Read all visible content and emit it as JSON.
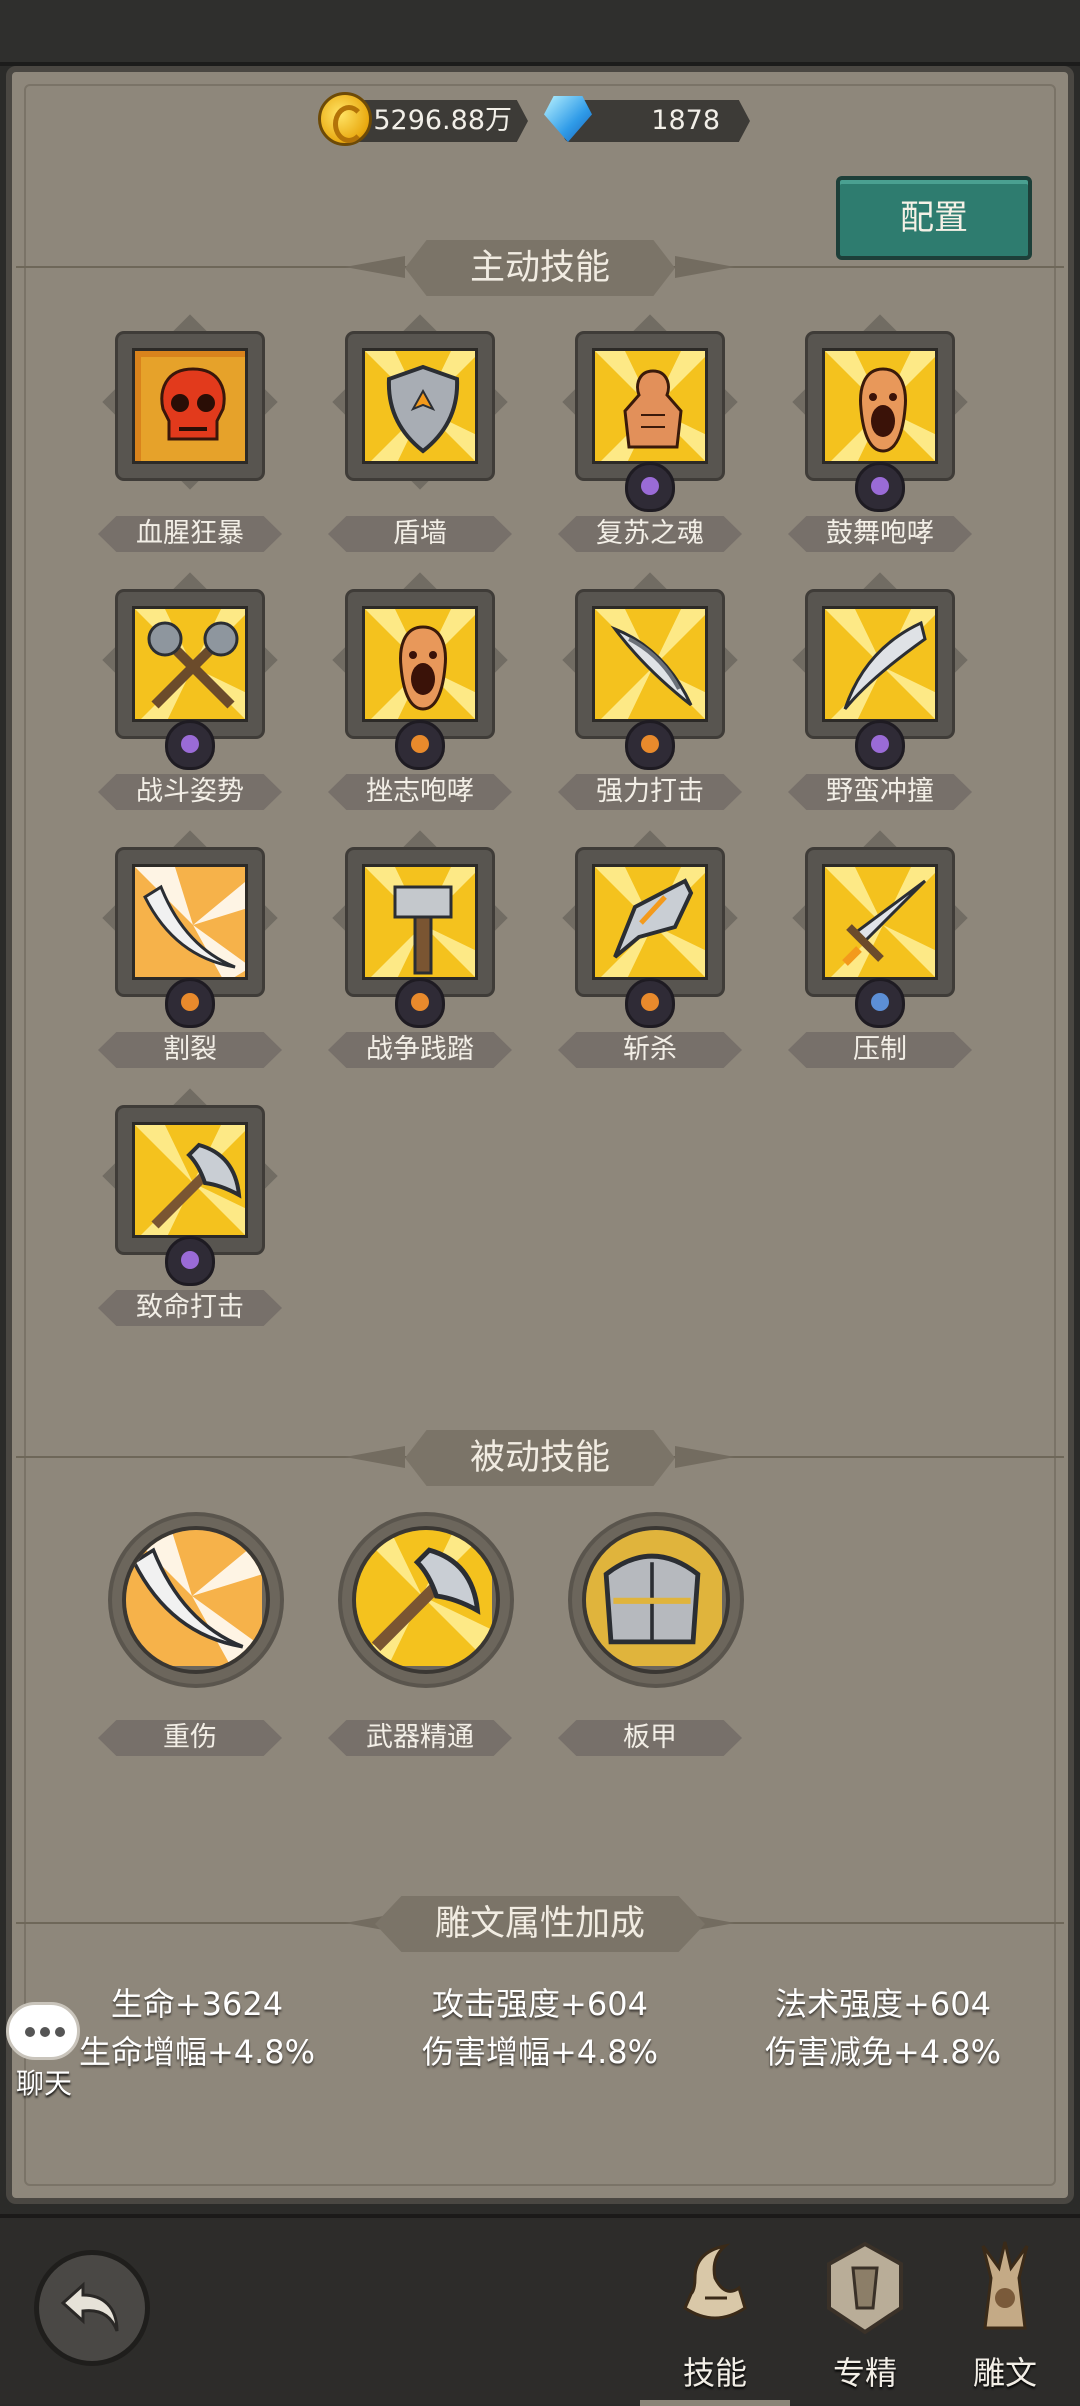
{
  "currency": {
    "gold": "5296.88万",
    "diamonds": "1878"
  },
  "config_button": "配置",
  "sections": {
    "active": "主动技能",
    "passive": "被动技能",
    "rune": "雕文属性加成"
  },
  "active_skills": [
    {
      "name": "血腥狂暴",
      "icon": "skull-icon",
      "badge": ""
    },
    {
      "name": "盾墙",
      "icon": "shield-icon",
      "badge": ""
    },
    {
      "name": "复苏之魂",
      "icon": "revive-icon",
      "badge": "purple"
    },
    {
      "name": "鼓舞咆哮",
      "icon": "roar-icon",
      "badge": "purple"
    },
    {
      "name": "战斗姿势",
      "icon": "crossed-maces-icon",
      "badge": "purple"
    },
    {
      "name": "挫志咆哮",
      "icon": "roar-icon",
      "badge": "orange"
    },
    {
      "name": "强力打击",
      "icon": "blade-strike-icon",
      "badge": "orange"
    },
    {
      "name": "野蛮冲撞",
      "icon": "charge-icon",
      "badge": "purple"
    },
    {
      "name": "割裂",
      "icon": "slash-icon",
      "badge": "orange"
    },
    {
      "name": "战争践踏",
      "icon": "hammer-icon",
      "badge": "orange"
    },
    {
      "name": "斩杀",
      "icon": "execute-icon",
      "badge": "orange"
    },
    {
      "name": "压制",
      "icon": "sword-icon",
      "badge": "blue"
    },
    {
      "name": "致命打击",
      "icon": "axe-icon",
      "badge": "purple"
    }
  ],
  "passive_skills": [
    {
      "name": "重伤",
      "icon": "slash-icon"
    },
    {
      "name": "武器精通",
      "icon": "axe-icon"
    },
    {
      "name": "板甲",
      "icon": "plate-armor-icon"
    }
  ],
  "rune_stats": [
    [
      "生命+3624",
      "攻击强度+604",
      "法术强度+604"
    ],
    [
      "生命增幅+4.8%",
      "伤害增幅+4.8%",
      "伤害减免+4.8%"
    ]
  ],
  "chat_label": "聊天",
  "tabs": [
    {
      "label": "技能",
      "active": true
    },
    {
      "label": "专精",
      "active": false
    },
    {
      "label": "雕文",
      "active": false
    }
  ]
}
